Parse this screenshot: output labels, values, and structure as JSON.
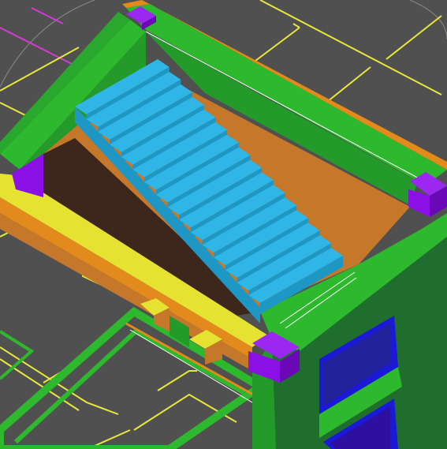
{
  "viewport": {
    "background": "#505050",
    "view": "3d-perspective-model"
  },
  "palette": {
    "background": "#505050",
    "yellow_lines": "#e8e83a",
    "magenta_lines": "#d43bd4",
    "green_walls": "#2db82d",
    "green_dark": "#1f6e2d",
    "green_mid": "#239a2a",
    "orange_trim": "#e28a1c",
    "orange_floor": "#c5782a",
    "brown_wall": "#3d271d",
    "cyan_stair_top": "#2fb6e6",
    "cyan_stair_side": "#1f97c4",
    "purple_caps": "#8a10e6",
    "yellow_beam": "#e6e232",
    "blue_window": "#1b18d8",
    "white_edge": "#ffffff"
  },
  "objects": {
    "stair_step_count": 16,
    "purple_cap_count": 4,
    "window_count": 2
  }
}
